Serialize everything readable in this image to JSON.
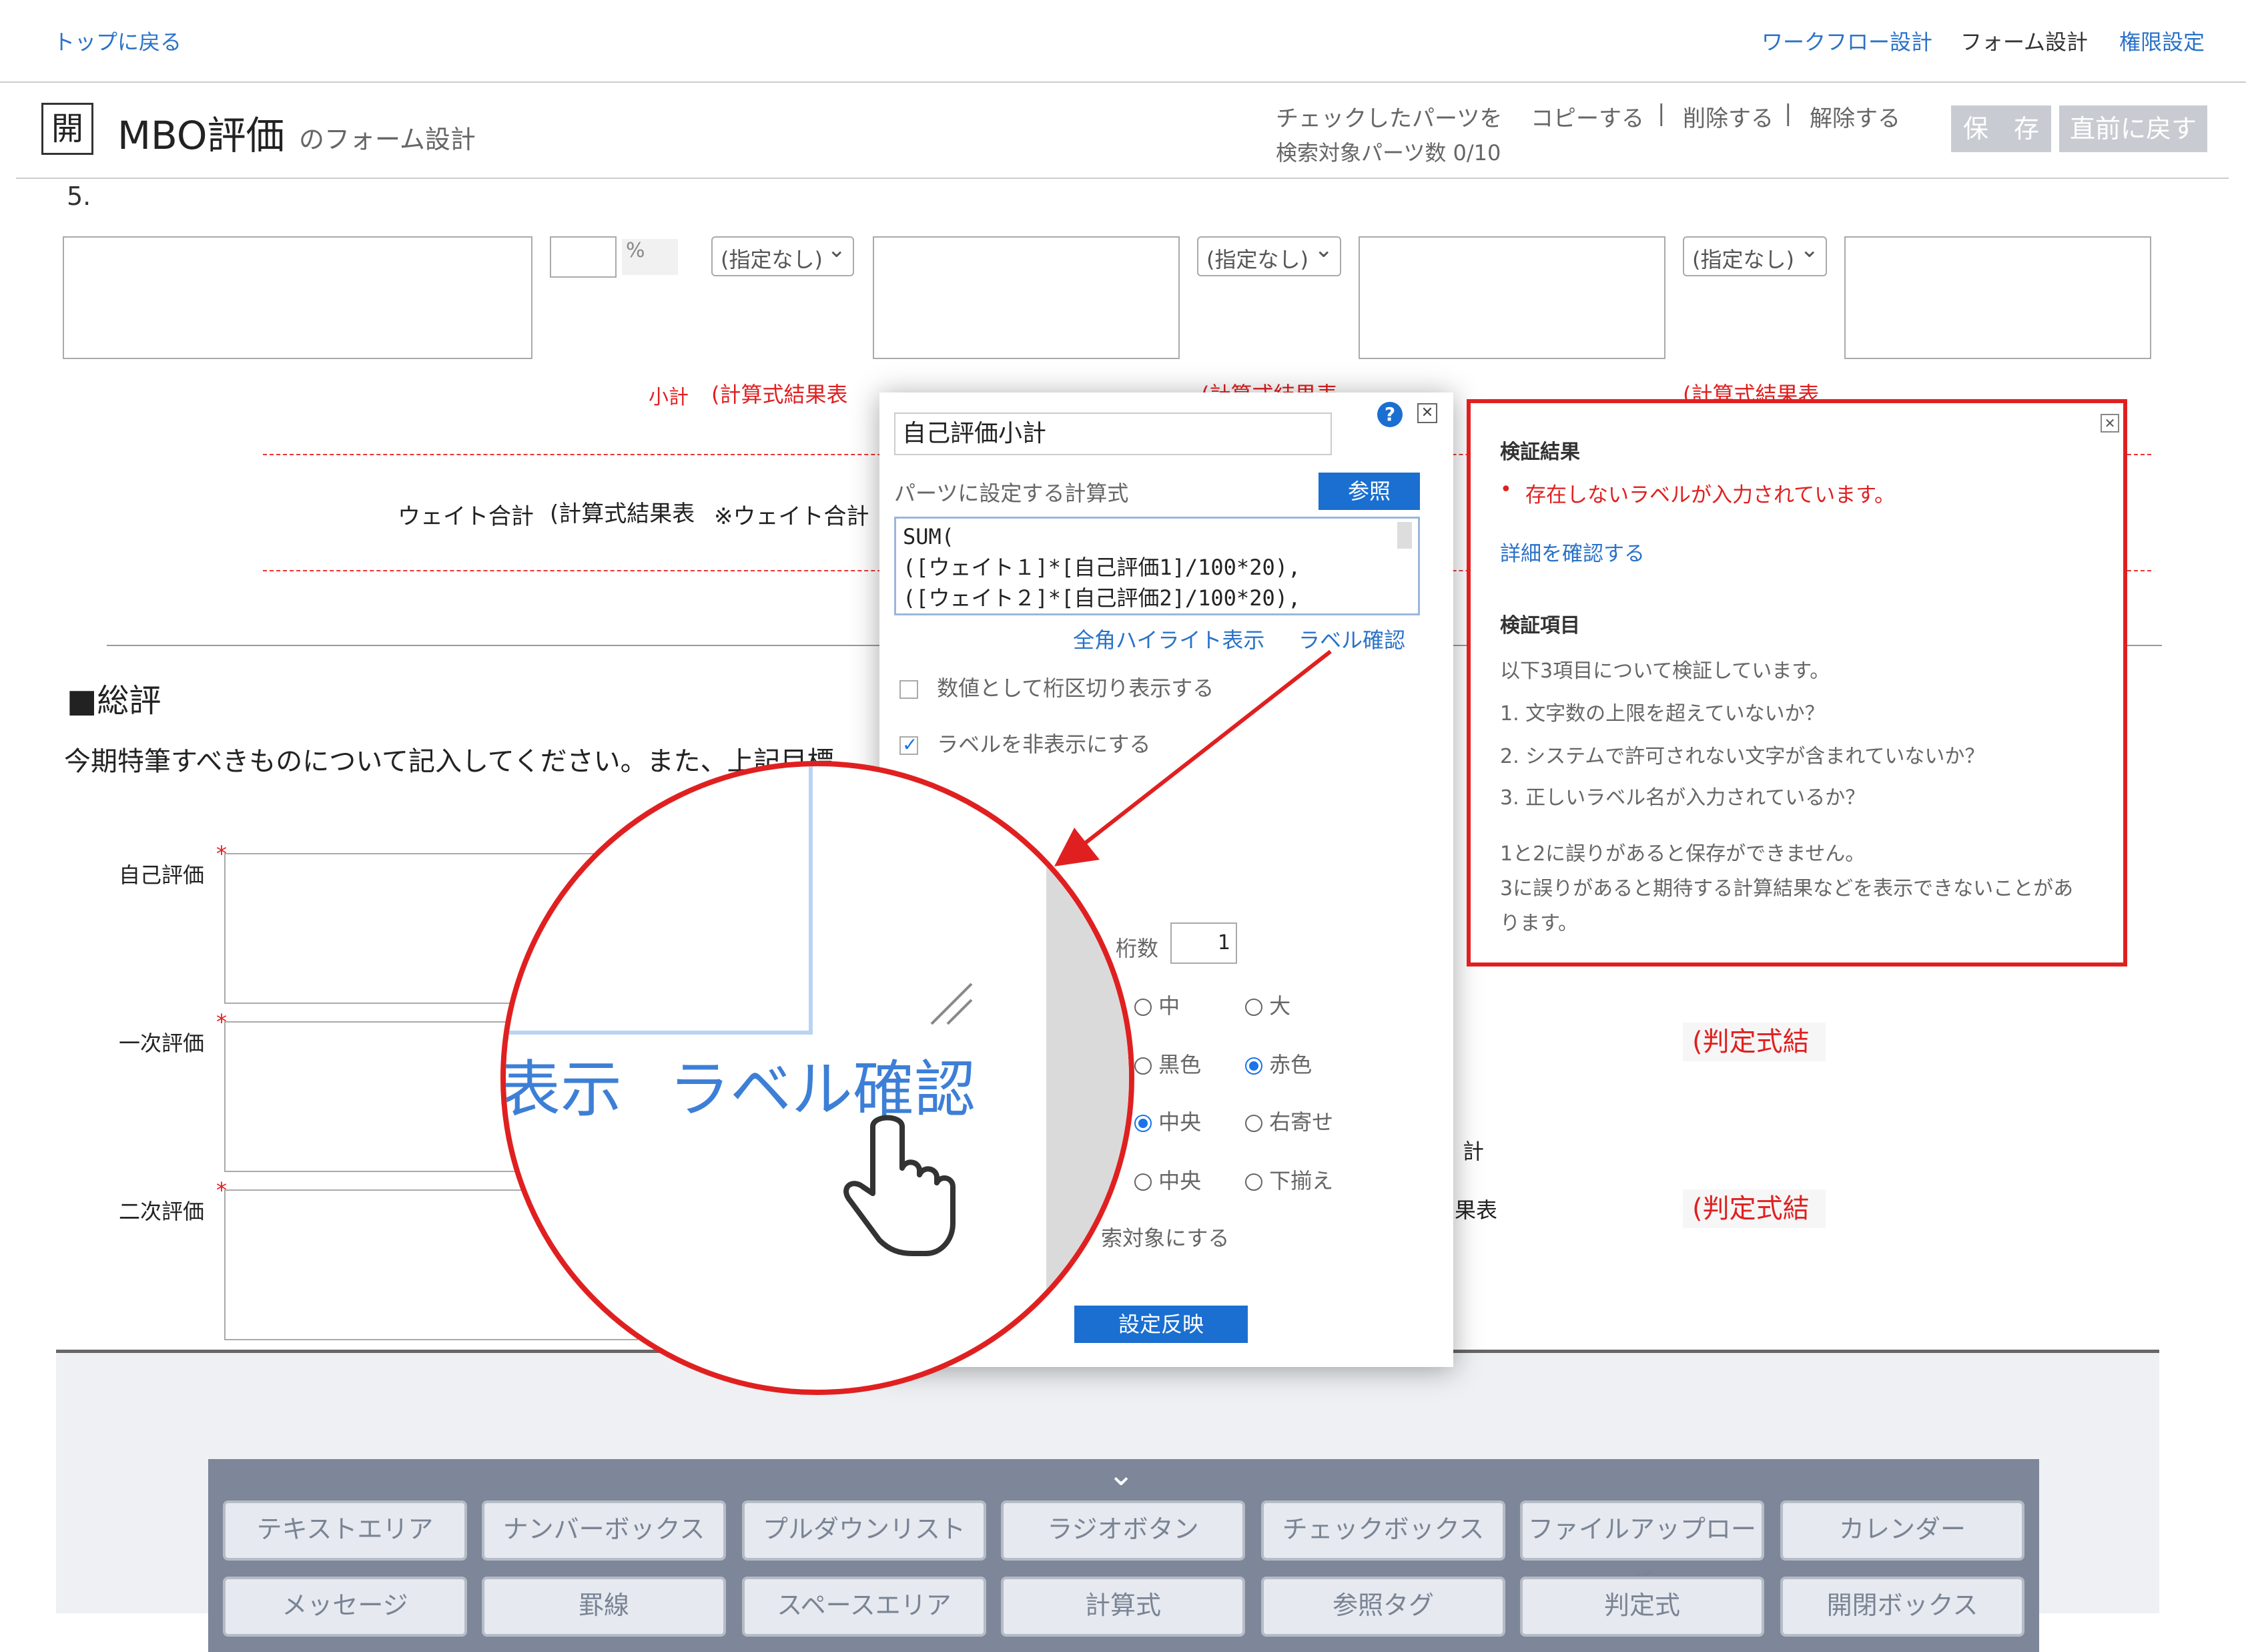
{
  "nav": {
    "back": "トップに戻る",
    "workflow": "ワークフロー設計",
    "form": "フォーム設計",
    "permission": "権限設定"
  },
  "header": {
    "badge": "開",
    "title": "MBO評価",
    "subtitle": "のフォーム設計",
    "checked_parts": "チェックしたパーツを",
    "copy": "コピーする",
    "delete": "削除する",
    "release": "解除する",
    "search_count": "検索対象パーツ数 0/10",
    "save": "保　存",
    "revert": "直前に戻す",
    "sep": "|"
  },
  "form": {
    "row_number": "5.",
    "percent": "%",
    "select_default": "(指定なし)",
    "subtotal_label": "小計",
    "calc_result": "(計算式結果表",
    "weight_total": "ウェイト合計",
    "weight_note": "※ウェイト合計",
    "section_title": "■総評",
    "instruction": "今期特筆すべきものについて記入してください。また、上記目標",
    "self_eval": "自己評価",
    "first_eval": "一次評価",
    "second_eval": "二次評価",
    "required": "*",
    "judge_result": "(判定式結",
    "partial_total": "計",
    "partial_result": "果表"
  },
  "popup": {
    "name_value": "自己評価小計",
    "formula_label": "パーツに設定する計算式",
    "ref_button": "参照",
    "formula_lines": [
      "SUM(",
      "([ウェイト１]*[自己評価1]/100*20),",
      "([ウェイト２]*[自己評価2]/100*20),"
    ],
    "highlight_link": "全角ハイライト表示",
    "label_check_link": "ラベル確認",
    "opt_separator": "数値として桁区切り表示する",
    "opt_hide_label": "ラベルを非表示にする",
    "digits_label": "桁数",
    "digits_value": "1",
    "size_mid": "中",
    "size_large": "大",
    "color_black": "黒色",
    "color_red": "赤色",
    "align_center": "中央",
    "align_right": "右寄せ",
    "valign_center": "中央",
    "valign_bottom": "下揃え",
    "search_target": "索対象にする",
    "apply_button": "設定反映"
  },
  "zoom": {
    "text_left": "表示",
    "text_main": "ラベル確認"
  },
  "validation": {
    "title": "検証結果",
    "error": "存在しないラベルが入力されています。",
    "detail_link": "詳細を確認する",
    "items_title": "検証項目",
    "intro": "以下3項目について検証しています。",
    "item1": "1. 文字数の上限を超えていないか？",
    "item2": "2. システムで許可されない文字が含まれていないか？",
    "item3": "3. 正しいラベル名が入力されているか？",
    "note1": "1と2に誤りがあると保存ができません。",
    "note2": "3に誤りがあると期待する計算結果などを表示できないことがあ",
    "note3": "ります。"
  },
  "palette": {
    "row1": [
      "テキストエリア",
      "ナンバーボックス",
      "プルダウンリスト",
      "ラジオボタン",
      "チェックボックス",
      "ファイルアップロード",
      "カレンダー"
    ],
    "row2": [
      "メッセージ",
      "罫線",
      "スペースエリア",
      "計算式",
      "参照タグ",
      "判定式",
      "開閉ボックス"
    ]
  },
  "colors": {
    "accent": "#2a72c8",
    "alert": "#e02020",
    "primary_button": "#1a6fd0"
  }
}
